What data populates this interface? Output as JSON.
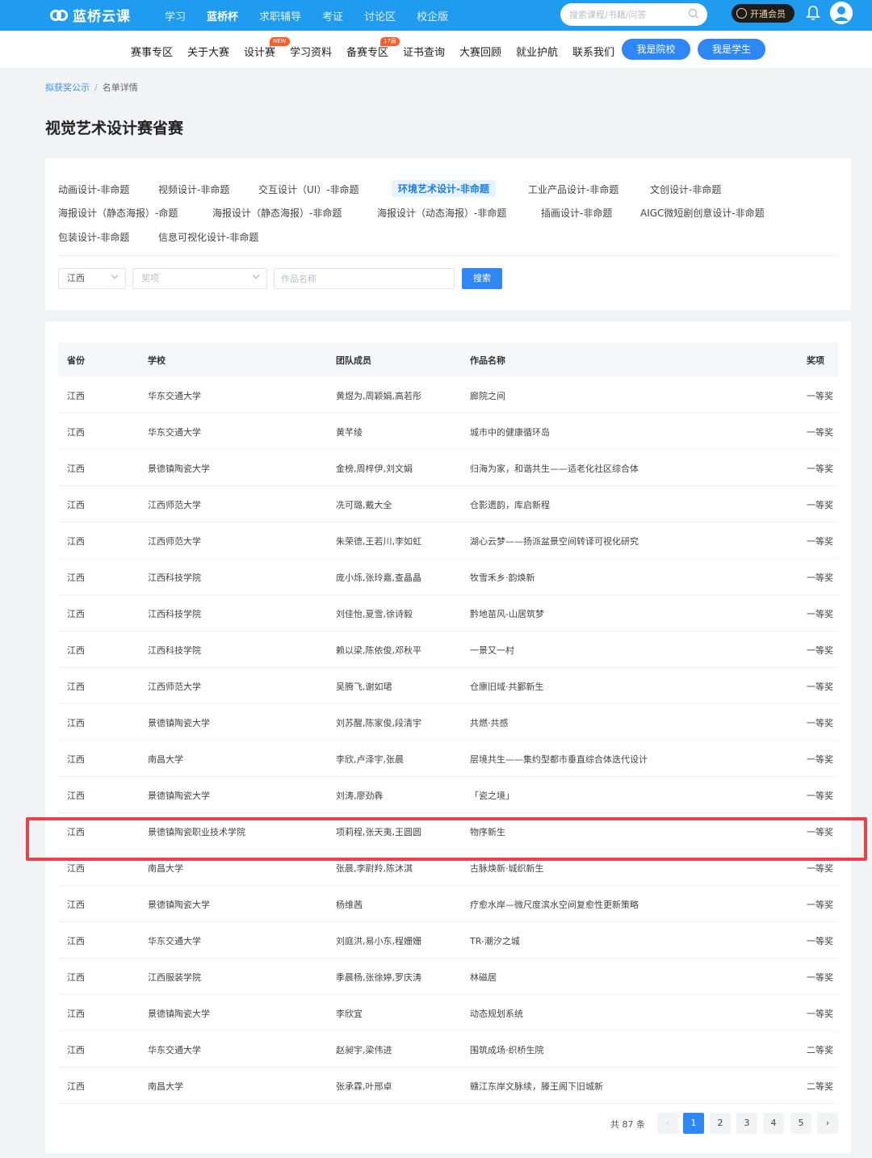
{
  "app": {
    "logo_text": "蓝桥云课",
    "nav": [
      "学习",
      "蓝桥杯",
      "求职辅导",
      "考证",
      "讨论区",
      "校企版"
    ],
    "search_placeholder": "搜索课程/书籍/问答",
    "vip_label": "开通会员"
  },
  "subnav": {
    "items": [
      "赛事专区",
      "关于大赛",
      "设计赛",
      "学习资料",
      "备赛专区",
      "证书查询",
      "大赛回顾",
      "就业护航",
      "联系我们"
    ],
    "badge_new": "NEW",
    "badge_count": "17届",
    "school_button": "我是院校",
    "student_button": "我是学生"
  },
  "breadcrumb": {
    "parent": "拟获奖公示",
    "separator": "/",
    "current": "名单详情"
  },
  "page_title": "视觉艺术设计赛省赛",
  "categories": [
    "动画设计-非命题",
    "视频设计-非命题",
    "交互设计（UI）-非命题",
    "环境艺术设计-非命题",
    "工业产品设计-非命题",
    "文创设计-非命题",
    "海报设计（静态海报）-命题",
    "海报设计（静态海报）-非命题",
    "海报设计（动态海报）-非命题",
    "插画设计-非命题",
    "AIGC微短剧创意设计-非命题",
    "包装设计-非命题",
    "信息可视化设计-非命题"
  ],
  "active_category": "环境艺术设计-非命题",
  "filters": {
    "province_value": "江西",
    "award_placeholder": "奖项",
    "work_placeholder": "作品名称",
    "search_button": "搜索"
  },
  "table": {
    "headers": [
      "省份",
      "学校",
      "团队成员",
      "作品名称",
      "奖项"
    ],
    "rows": [
      [
        "江西",
        "华东交通大学",
        "黄煜为,周颖娟,高若彤",
        "廊院之间",
        "一等奖"
      ],
      [
        "江西",
        "华东交通大学",
        "黄芊绫",
        "城市中的健康循环岛",
        "一等奖"
      ],
      [
        "江西",
        "景德镇陶瓷大学",
        "金榜,周梓伊,刘文娟",
        "归海为家，和谐共生——适老化社区综合体",
        "一等奖"
      ],
      [
        "江西",
        "江西师范大学",
        "冼可璐,戴大全",
        "仓影遗韵，库启新程",
        "一等奖"
      ],
      [
        "江西",
        "江西师范大学",
        "朱荣德,王若川,李如虹",
        "湖心云梦——扬派盆景空间转译可视化研究",
        "一等奖"
      ],
      [
        "江西",
        "江西科技学院",
        "庞小烁,张玲嘉,查晶晶",
        "牧雪禾乡·韵焕新",
        "一等奖"
      ],
      [
        "江西",
        "江西科技学院",
        "刘佳怡,夏雪,徐诗毅",
        "黔地苗风-山居筑梦",
        "一等奖"
      ],
      [
        "江西",
        "江西科技学院",
        "赖以梁,陈依俊,邓秋平",
        "一景又一村",
        "一等奖"
      ],
      [
        "江西",
        "江西师范大学",
        "吴腾飞,谢如珺",
        "仓廪旧域·共鄞新生",
        "一等奖"
      ],
      [
        "江西",
        "景德镇陶瓷大学",
        "刘苏醒,陈家俊,段清宇",
        "共燃·共感",
        "一等奖"
      ],
      [
        "江西",
        "南昌大学",
        "李欣,卢泽宇,张晨",
        "层境共生——集约型都市垂直综合体迭代设计",
        "一等奖"
      ],
      [
        "江西",
        "景德镇陶瓷大学",
        "刘涛,廖劲犇",
        "「瓷之境」",
        "一等奖"
      ],
      [
        "江西",
        "景德镇陶瓷职业技术学院",
        "项莉程,张天夷,王圆圆",
        "物序新生",
        "一等奖"
      ],
      [
        "江西",
        "南昌大学",
        "张晨,李尉羚,陈沐淇",
        "古脉焕新·城织新生",
        "一等奖"
      ],
      [
        "江西",
        "景德镇陶瓷大学",
        "杨维茜",
        "疗愈水岸—微尺度滨水空间复愈性更新策略",
        "一等奖"
      ],
      [
        "江西",
        "华东交通大学",
        "刘庭洪,易小东,程姗姗",
        "TR-潮汐之城",
        "一等奖"
      ],
      [
        "江西",
        "江西服装学院",
        "季晨杨,张徐婷,罗庆涛",
        "林磁居",
        "一等奖"
      ],
      [
        "江西",
        "景德镇陶瓷大学",
        "李欣宜",
        "动态规划系统",
        "一等奖"
      ],
      [
        "江西",
        "华东交通大学",
        "赵昶宇,梁伟进",
        "围筑成场·织桥生院",
        "二等奖"
      ],
      [
        "江西",
        "南昌大学",
        "张承霖,叶邢卓",
        "赣江东岸文脉续，滕王阁下旧城新",
        "二等奖"
      ]
    ]
  },
  "pagination": {
    "total": "共 87 条",
    "prev": "‹",
    "next": "›",
    "pages": [
      "1",
      "2",
      "3",
      "4",
      "5"
    ],
    "current": "1"
  },
  "colors": {
    "brand": "#1f9bf0",
    "accent": "#2f86f5",
    "highlight": "#e8424a"
  }
}
